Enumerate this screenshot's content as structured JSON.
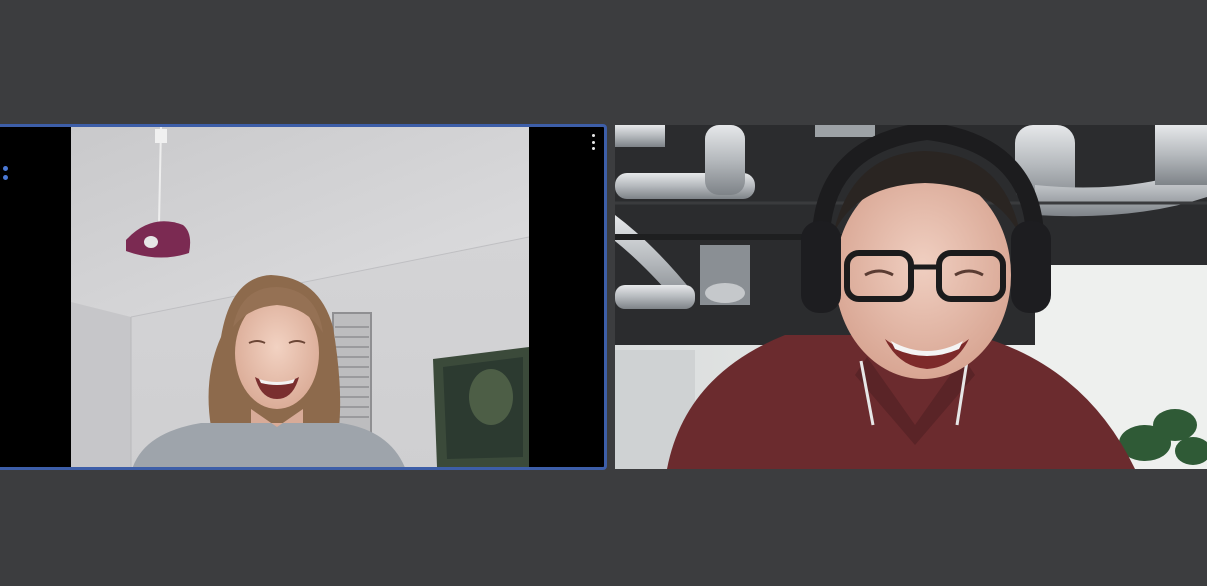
{
  "meeting": {
    "participants": [
      {
        "id": "tile-1",
        "active_speaker": true,
        "more_icon": "more-vertical-icon",
        "accent": "#3d5ea8"
      },
      {
        "id": "tile-2",
        "active_speaker": false
      }
    ],
    "gallery_handle_icon": "drag-handle-icon"
  },
  "colors": {
    "background": "#3c3d3f",
    "active_border": "#3d5ea8",
    "handle": "#4a78d4"
  }
}
